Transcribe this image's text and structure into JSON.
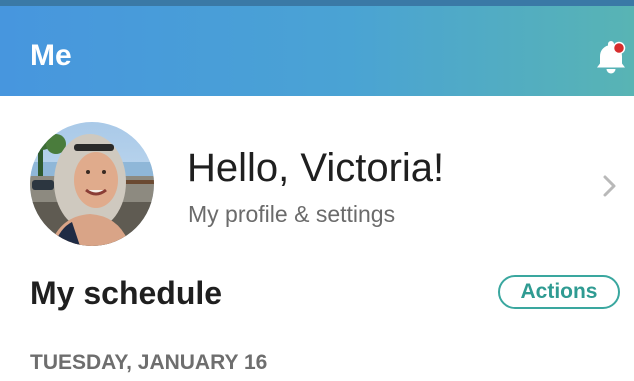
{
  "header": {
    "title": "Me",
    "notification_icon": "bell-with-dot-icon",
    "notification_dot_color": "#d62d2d"
  },
  "profile": {
    "greeting": "Hello, Victoria!",
    "subtitle": "My profile & settings",
    "avatar_icon": "user-avatar-photo",
    "chevron_icon": "chevron-right-icon"
  },
  "schedule": {
    "title": "My schedule",
    "actions_label": "Actions",
    "date_label": "TUESDAY, JANUARY 16"
  },
  "colors": {
    "header_gradient_start": "#4796de",
    "header_gradient_end": "#58b4b4",
    "accent": "#3aa79f"
  }
}
